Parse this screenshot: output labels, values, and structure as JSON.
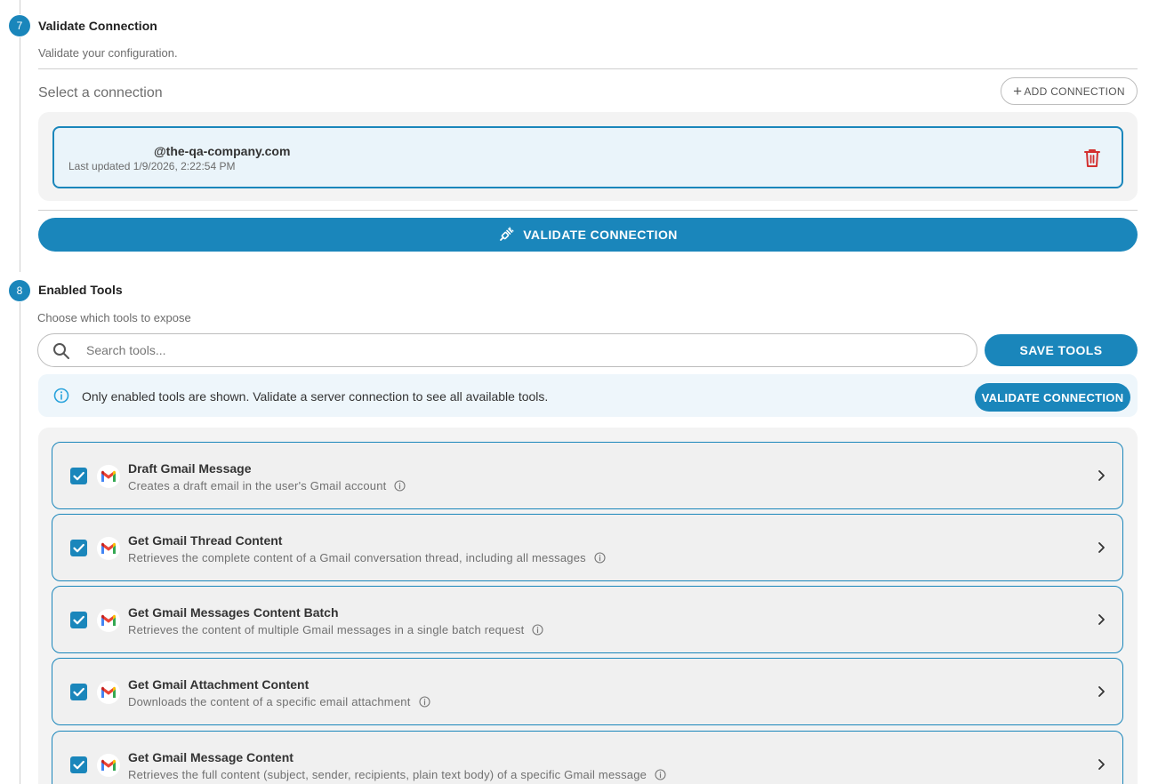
{
  "validate_step": {
    "number": "7",
    "title": "Validate Connection",
    "subtitle": "Validate your configuration.",
    "select_label": "Select a connection",
    "add_connection_label": "ADD CONNECTION",
    "connection": {
      "email": "@the-qa-company.com",
      "last_updated": "Last updated 1/9/2026, 2:22:54 PM"
    },
    "validate_button_label": "VALIDATE CONNECTION"
  },
  "tools_step": {
    "number": "8",
    "title": "Enabled Tools",
    "subtitle": "Choose which tools to expose",
    "search_placeholder": "Search tools...",
    "save_button_label": "SAVE TOOLS",
    "info_text": "Only enabled tools are shown. Validate a server connection to see all available tools.",
    "info_validate_label": "VALIDATE CONNECTION",
    "tools": [
      {
        "name": "Draft Gmail Message",
        "description": "Creates a draft email in the user's Gmail account",
        "enabled": true
      },
      {
        "name": "Get Gmail Thread Content",
        "description": "Retrieves the complete content of a Gmail conversation thread, including all messages",
        "enabled": true
      },
      {
        "name": "Get Gmail Messages Content Batch",
        "description": "Retrieves the content of multiple Gmail messages in a single batch request",
        "enabled": true
      },
      {
        "name": "Get Gmail Attachment Content",
        "description": "Downloads the content of a specific email attachment",
        "enabled": true
      },
      {
        "name": "Get Gmail Message Content",
        "description": "Retrieves the full content (subject, sender, recipients, plain text body) of a specific Gmail message",
        "enabled": true
      }
    ]
  },
  "colors": {
    "accent": "#1a86bb",
    "danger": "#d32f2f"
  }
}
